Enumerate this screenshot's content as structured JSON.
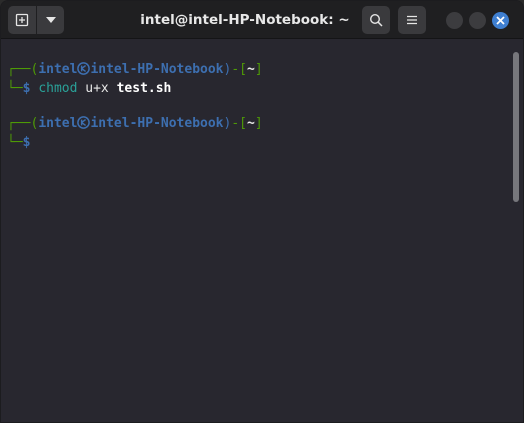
{
  "window": {
    "title": "intel@intel-HP-Notebook: ~"
  },
  "header": {
    "icons": {
      "new_tab": "new-tab-icon",
      "dropdown": "chevron-down-icon",
      "search": "search-icon",
      "menu": "hamburger-menu-icon",
      "close": "close-icon"
    },
    "accent_color": "#3f7fd1"
  },
  "terminal": {
    "prompts": [
      {
        "corner_top": "┌──(",
        "user": "intel",
        "separator_icon": "kali-skull-icon",
        "host": "intel-HP-Notebook",
        "close_paren": ")",
        "dash": "-[",
        "cwd": "~",
        "close_bracket": "]",
        "corner_bottom": "└─",
        "dollar": "$",
        "command": "chmod",
        "args": " u+x ",
        "arg_file": "test.sh"
      },
      {
        "corner_top": "┌──(",
        "user": "intel",
        "separator_icon": "kali-skull-icon",
        "host": "intel-HP-Notebook",
        "close_paren": ")",
        "dash": "-[",
        "cwd": "~",
        "close_bracket": "]",
        "corner_bottom": "└─",
        "dollar": "$",
        "command": "",
        "args": "",
        "arg_file": ""
      }
    ],
    "colors": {
      "frame": "#4e9a06",
      "user_host": "#3d6fb0",
      "command": "#2aa198",
      "background": "#28272f"
    }
  }
}
